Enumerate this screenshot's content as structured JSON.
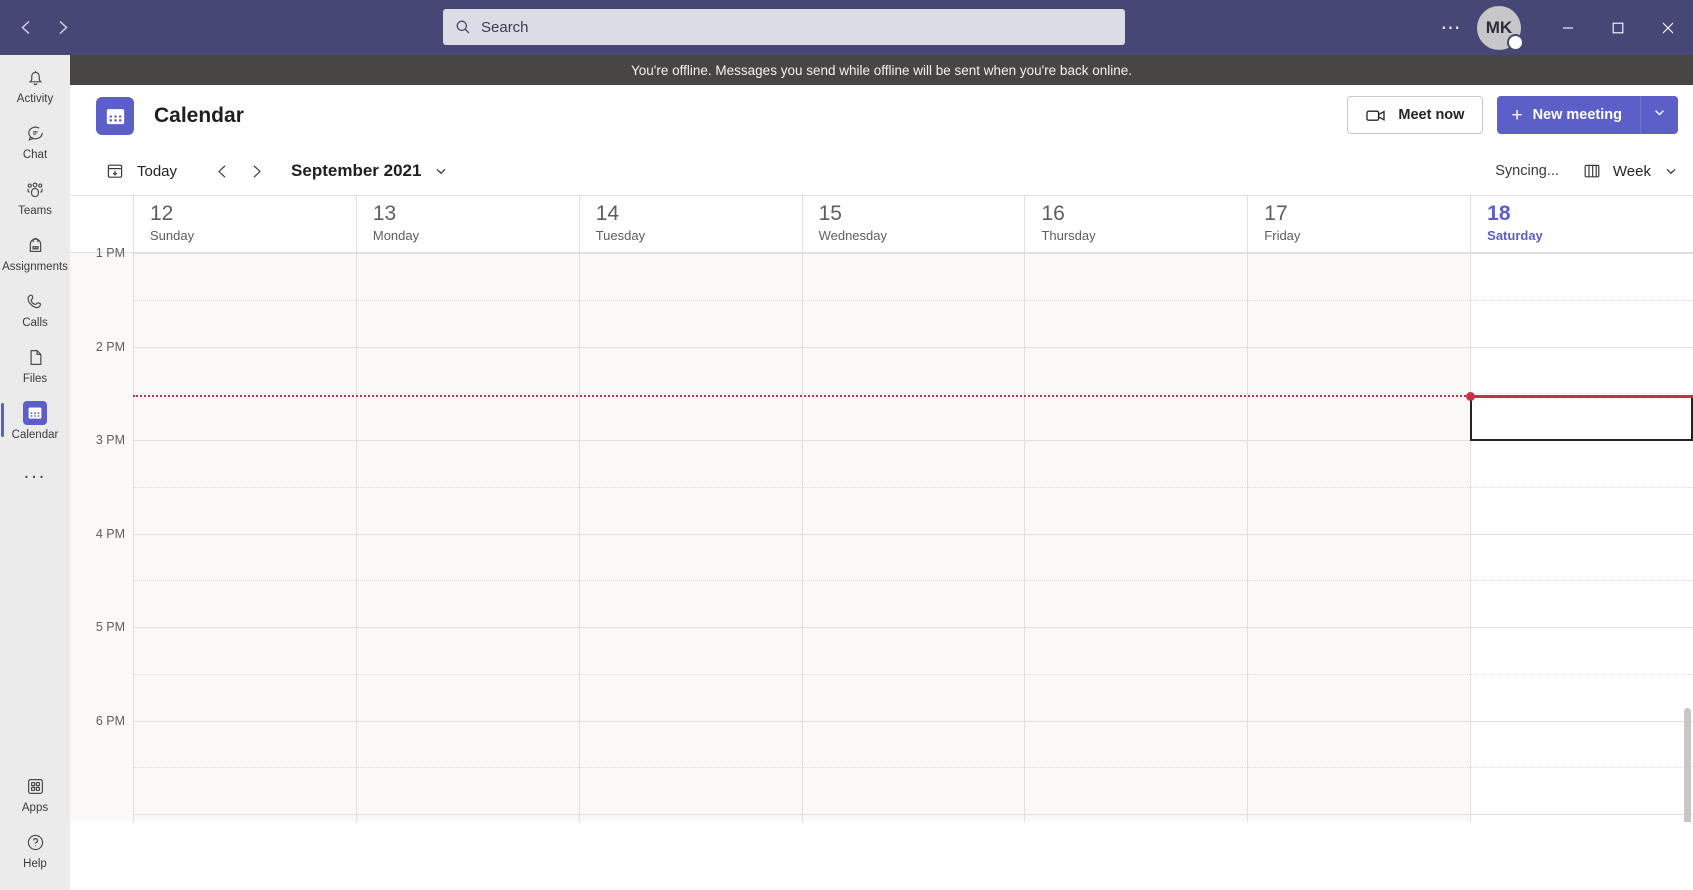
{
  "titlebar": {
    "back_label": "Back",
    "forward_label": "Forward",
    "search_placeholder": "Search",
    "more_label": "Settings and more",
    "avatar_initials": "MK",
    "presence_status": "Offline",
    "minimize_label": "Minimize",
    "maximize_label": "Maximize",
    "close_label": "Close",
    "bg_color": "#464775"
  },
  "rail": {
    "items": [
      {
        "label": "Activity",
        "icon": "bell-icon",
        "active": false
      },
      {
        "label": "Chat",
        "icon": "chat-icon",
        "active": false
      },
      {
        "label": "Teams",
        "icon": "teams-icon",
        "active": false
      },
      {
        "label": "Assignments",
        "icon": "backpack-icon",
        "active": false
      },
      {
        "label": "Calls",
        "icon": "phone-icon",
        "active": false
      },
      {
        "label": "Files",
        "icon": "file-icon",
        "active": false
      },
      {
        "label": "Calendar",
        "icon": "calendar-icon",
        "active": true
      }
    ],
    "more_label": "...",
    "bottom_items": [
      {
        "label": "Apps",
        "icon": "apps-grid-icon"
      },
      {
        "label": "Help",
        "icon": "help-circle-icon"
      }
    ],
    "accent_color": "#5b5fc7"
  },
  "offline_banner": {
    "message": "You're offline. Messages you send while offline will be sent when you're back online.",
    "bg_color": "#484644"
  },
  "header": {
    "app_icon": "calendar-icon",
    "title": "Calendar",
    "meet_now_label": "Meet now",
    "meet_now_icon": "video-camera-icon",
    "new_meeting_label": "New meeting",
    "new_meeting_plus": "+",
    "new_meeting_caret": "chevron-down-icon",
    "accent_color": "#5b5fc7"
  },
  "toolbar": {
    "today_label": "Today",
    "today_icon": "calendar-today-icon",
    "prev_label": "Previous week",
    "next_label": "Next week",
    "period_label": "September 2021",
    "period_caret": "chevron-down-icon",
    "sync_status": "Syncing...",
    "view_label": "Week",
    "view_icon": "week-view-icon",
    "view_caret": "chevron-down-icon"
  },
  "calendar": {
    "days": [
      {
        "num": "12",
        "name": "Sunday",
        "today": false
      },
      {
        "num": "13",
        "name": "Monday",
        "today": false
      },
      {
        "num": "14",
        "name": "Tuesday",
        "today": false
      },
      {
        "num": "15",
        "name": "Wednesday",
        "today": false
      },
      {
        "num": "16",
        "name": "Thursday",
        "today": false
      },
      {
        "num": "17",
        "name": "Friday",
        "today": false
      },
      {
        "num": "18",
        "name": "Saturday",
        "today": true
      }
    ],
    "hours": [
      "1 PM",
      "2 PM",
      "3 PM",
      "4 PM",
      "5 PM",
      "6 PM"
    ],
    "now_indicator_color": "#c4314b",
    "selection_border_color": "#242424",
    "events": []
  }
}
